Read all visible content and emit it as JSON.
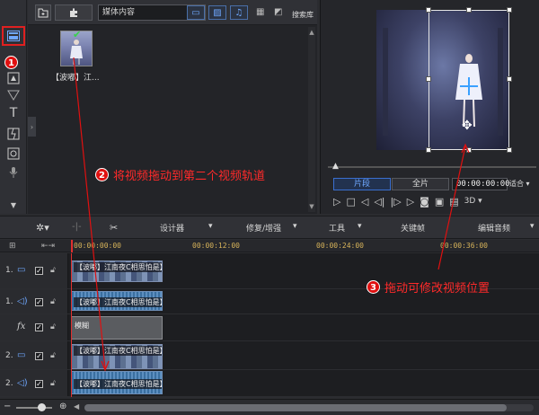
{
  "media_toolbar": {
    "import_icon": "import-icon",
    "plugin_icon": "plugin-icon",
    "select_value": "媒体内容",
    "search_label": "搜索库"
  },
  "media_item": {
    "label": "【波嘟】江..."
  },
  "preview": {
    "tab_clip": "片段",
    "tab_full": "全片",
    "timecode": "00:00:00:00",
    "fit_label": "适合 ▾",
    "mode_3d": "3D ▾"
  },
  "edit_toolbar": {
    "designer": "设计器",
    "repair": "修复/增强",
    "tools": "工具",
    "keyframe": "关键帧",
    "edit_audio": "编辑音频"
  },
  "ruler": {
    "t0": "00:00:00:00",
    "t1": "00:00:12:00",
    "t2": "00:00:24:00",
    "t3": "00:00:36:00"
  },
  "tracks": {
    "v1_num": "1.",
    "a1_num": "1.",
    "v2_num": "2.",
    "a2_num": "2.",
    "fx_label": "fx",
    "clip_title": "【波嘟】江南夜C相思怕是】",
    "fx_clip": "模糊"
  },
  "annotations": {
    "step1": "1",
    "step2": "2",
    "step2_text": "将视频拖动到第二个视频轨道",
    "step3": "3",
    "step3_text": "拖动可修改视频位置"
  },
  "colors": {
    "accent": "#3a6fd0",
    "annotation_red": "#e01010",
    "ruler_text": "#d7b35a"
  }
}
